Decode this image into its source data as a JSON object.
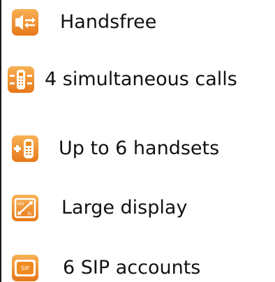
{
  "colors": {
    "accent": "#f08a1e",
    "accent_light": "#f7b154",
    "text": "#111111"
  },
  "features": [
    {
      "icon": "handsfree-speaker-icon",
      "label": "Handsfree"
    },
    {
      "icon": "simultaneous-calls-icon",
      "label": "4 simultaneous calls"
    },
    {
      "icon": "add-handset-icon",
      "label": "Up to 6 handsets"
    },
    {
      "icon": "large-display-icon",
      "label": "Large display",
      "icon_text": [
        "HD",
        "XL"
      ]
    },
    {
      "icon": "sip-accounts-icon",
      "label": "6 SIP accounts",
      "icon_text": [
        "SIP"
      ]
    }
  ]
}
